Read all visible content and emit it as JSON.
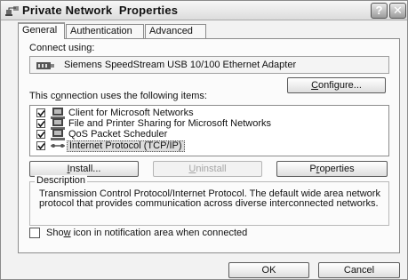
{
  "window": {
    "title": "Private Network  Properties",
    "help_button": "?",
    "close_button": "✕"
  },
  "tabs": [
    {
      "label": "General",
      "active": true
    },
    {
      "label": "Authentication",
      "active": false
    },
    {
      "label": "Advanced",
      "active": false
    }
  ],
  "connect_using": {
    "label": "Connect using:",
    "adapter_name": "Siemens SpeedStream USB 10/100 Ethernet Adapter",
    "adapter_icon": "network-adapter-icon"
  },
  "configure_button": {
    "prefix": "",
    "mnemonic": "C",
    "rest": "onfigure..."
  },
  "items_section": {
    "label_prefix": "This c",
    "label_mnemonic": "o",
    "label_rest": "nnection uses the following items:",
    "items": [
      {
        "label": "Client for Microsoft Networks",
        "checked": true,
        "icon": "client-network-icon",
        "selected": false
      },
      {
        "label": "File and Printer Sharing for Microsoft Networks",
        "checked": true,
        "icon": "file-printer-sharing-icon",
        "selected": false
      },
      {
        "label": "QoS Packet Scheduler",
        "checked": true,
        "icon": "qos-scheduler-icon",
        "selected": false
      },
      {
        "label": "Internet Protocol (TCP/IP)",
        "checked": true,
        "icon": "protocol-icon",
        "selected": true
      }
    ]
  },
  "action_buttons": {
    "install": {
      "prefix": "",
      "mnemonic": "I",
      "rest": "nstall...",
      "enabled": true
    },
    "uninstall": {
      "prefix": "",
      "mnemonic": "U",
      "rest": "ninstall",
      "enabled": false
    },
    "properties": {
      "prefix": "P",
      "mnemonic": "r",
      "rest": "operties",
      "enabled": true
    }
  },
  "description": {
    "title": "Description",
    "text": "Transmission Control Protocol/Internet Protocol. The default wide area network protocol that provides communication across diverse interconnected networks."
  },
  "show_icon": {
    "prefix": "Sho",
    "mnemonic": "w",
    "rest": " icon in notification area when connected",
    "checked": false
  },
  "footer": {
    "ok_label": "OK",
    "cancel_label": "Cancel"
  }
}
